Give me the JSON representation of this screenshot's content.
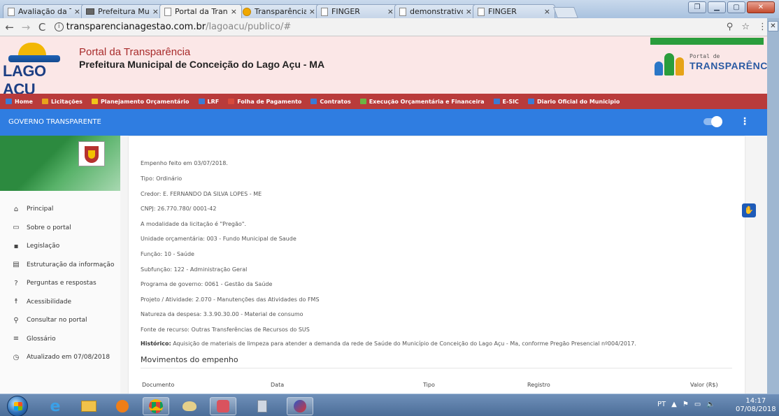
{
  "browser": {
    "tabs": [
      {
        "label": "Avaliação da Transp"
      },
      {
        "label": "Prefeitura Municipal"
      },
      {
        "label": "Portal da Transparên",
        "active": true
      },
      {
        "label": "Transparência"
      },
      {
        "label": "FINGER"
      },
      {
        "label": "demonstrativoConce"
      },
      {
        "label": "FINGER"
      }
    ],
    "tab_close": "×",
    "url_host": "transparencianagestao.com.br",
    "url_path": "/lagoacu/publico/#"
  },
  "header": {
    "logo_text": "LAGO AÇU",
    "title": "Portal da Transparência",
    "subtitle": "Prefeitura Municipal de Conceição do Lago Açu - MA",
    "right_logo_small": "Portal de",
    "right_logo_big": "TRANSPARÊNCIA"
  },
  "topnav": [
    {
      "label": "Home",
      "color": "#3a7bd5"
    },
    {
      "label": "Licitações",
      "color": "#e8a21b"
    },
    {
      "label": "Planejamento Orçamentário",
      "color": "#f0c419"
    },
    {
      "label": "LRF",
      "color": "#3a7bd5"
    },
    {
      "label": "Folha de Pagamento",
      "color": "#d84a3c"
    },
    {
      "label": "Contratos",
      "color": "#3a7bd5"
    },
    {
      "label": "Execução Orçamentária e Financeira",
      "color": "#6cb443"
    },
    {
      "label": "E-SIC",
      "color": "#3a7bd5"
    },
    {
      "label": "Diario Oficial do Municipio",
      "color": "#3a7bd5"
    }
  ],
  "govbar": {
    "title": "GOVERNO TRANSPARENTE"
  },
  "sidebar": {
    "items": [
      {
        "label": "Principal",
        "icon": "⌂"
      },
      {
        "label": "Sobre o portal",
        "icon": "▭"
      },
      {
        "label": "Legislação",
        "icon": "▪"
      },
      {
        "label": "Estruturação da informação",
        "icon": "▤"
      },
      {
        "label": "Perguntas e respostas",
        "icon": "?"
      },
      {
        "label": "Acessibilidade",
        "icon": "☨"
      },
      {
        "label": "Consultar no portal",
        "icon": "⚲"
      },
      {
        "label": "Glossário",
        "icon": "≡"
      },
      {
        "label": "Atualizado em 07/08/2018",
        "icon": "◷"
      }
    ]
  },
  "details": [
    "Empenho feito em 03/07/2018.",
    "Tipo: Ordinário",
    "Credor: E. FERNANDO DA SILVA LOPES - ME",
    "CNPJ: 26.770.780/ 0001-42",
    "A modalidade da licitação é \"Pregão\".",
    "Unidade orçamentária: 003 - Fundo Municipal de Saude",
    "Função: 10 - Saúde",
    "Subfunção: 122 - Administração Geral",
    "Programa de governo: 0061 - Gestão da Saúde",
    "Projeto / Atividade: 2.070 - Manutenções das Atividades do FMS",
    "Natureza da despesa: 3.3.90.30.00 - Material de consumo",
    "Fonte de recurso: Outras Transferências de Recursos do SUS"
  ],
  "historico": {
    "label": "Histórico:",
    "text": " Aquisição de materiais de limpeza para atender a demanda da rede de Saúde do Município de Conceição do Lago Açu - Ma, conforme Pregão Presencial nº004/2017."
  },
  "movimentos": {
    "title": "Movimentos do empenho",
    "headers": [
      "Documento",
      "Data",
      "Tipo",
      "Registro",
      "Valor (R$)"
    ]
  },
  "taskbar": {
    "lang": "PT",
    "time": "14:17",
    "date": "07/08/2018"
  }
}
